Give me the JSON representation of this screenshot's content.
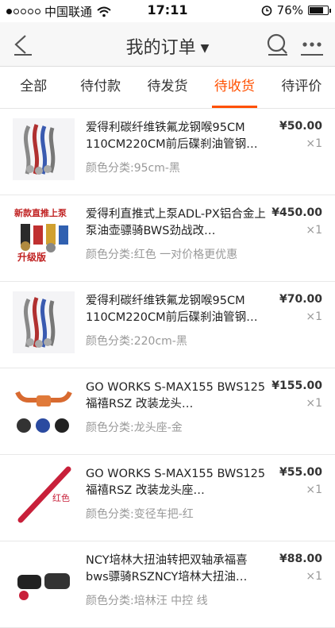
{
  "status_bar": {
    "carrier": "中国联通",
    "time": "17:11",
    "battery": "76%",
    "battery_level": 0.76
  },
  "nav": {
    "title": "我的订单"
  },
  "tabs": [
    {
      "label": "全部"
    },
    {
      "label": "待付款"
    },
    {
      "label": "待发货"
    },
    {
      "label": "待收货"
    },
    {
      "label": "待评价"
    }
  ],
  "orders": [
    {
      "name": "爱得利碳纤维铁氟龙钢喉95CM 110CM220CM前后碟刹油管钢…",
      "sku": "颜色分类:95cm-黑",
      "price": "¥50.00",
      "qty": "×1"
    },
    {
      "name": "爱得利直推式上泵ADL-PX铝合金上泵油壶骠骑BWS劲战改…",
      "sku": "颜色分类:红色  一对价格更优惠",
      "price": "¥450.00",
      "qty": "×1"
    },
    {
      "name": "爱得利碳纤维铁氟龙钢喉95CM 110CM220CM前后碟刹油管钢…",
      "sku": "颜色分类:220cm-黑",
      "price": "¥70.00",
      "qty": "×1"
    },
    {
      "name": "GO WORKS S-MAX155 BWS125福禧RSZ 改装龙头…",
      "sku": "颜色分类:龙头座-金",
      "price": "¥155.00",
      "qty": "×1"
    },
    {
      "name": "GO WORKS S-MAX155 BWS125福禧RSZ 改装龙头座…",
      "sku": "颜色分类:变径车把-红",
      "price": "¥55.00",
      "qty": "×1"
    },
    {
      "name": "NCY培林大扭油转把双轴承福喜bws骠骑RSZNCY培林大扭油…",
      "sku": "颜色分类:培林汪  中控  线",
      "price": "¥88.00",
      "qty": "×1"
    }
  ],
  "thumb_text": {
    "t2_top": "新款直推上泵",
    "t2_bottom": "升级版",
    "t5_label": "红色"
  },
  "colors": {
    "accent": "#ff5000"
  },
  "icons": [
    "back-arrow-icon",
    "dropdown-caret-icon",
    "search-icon",
    "more-dots-icon",
    "wifi-icon",
    "alarm-icon",
    "battery-icon"
  ]
}
